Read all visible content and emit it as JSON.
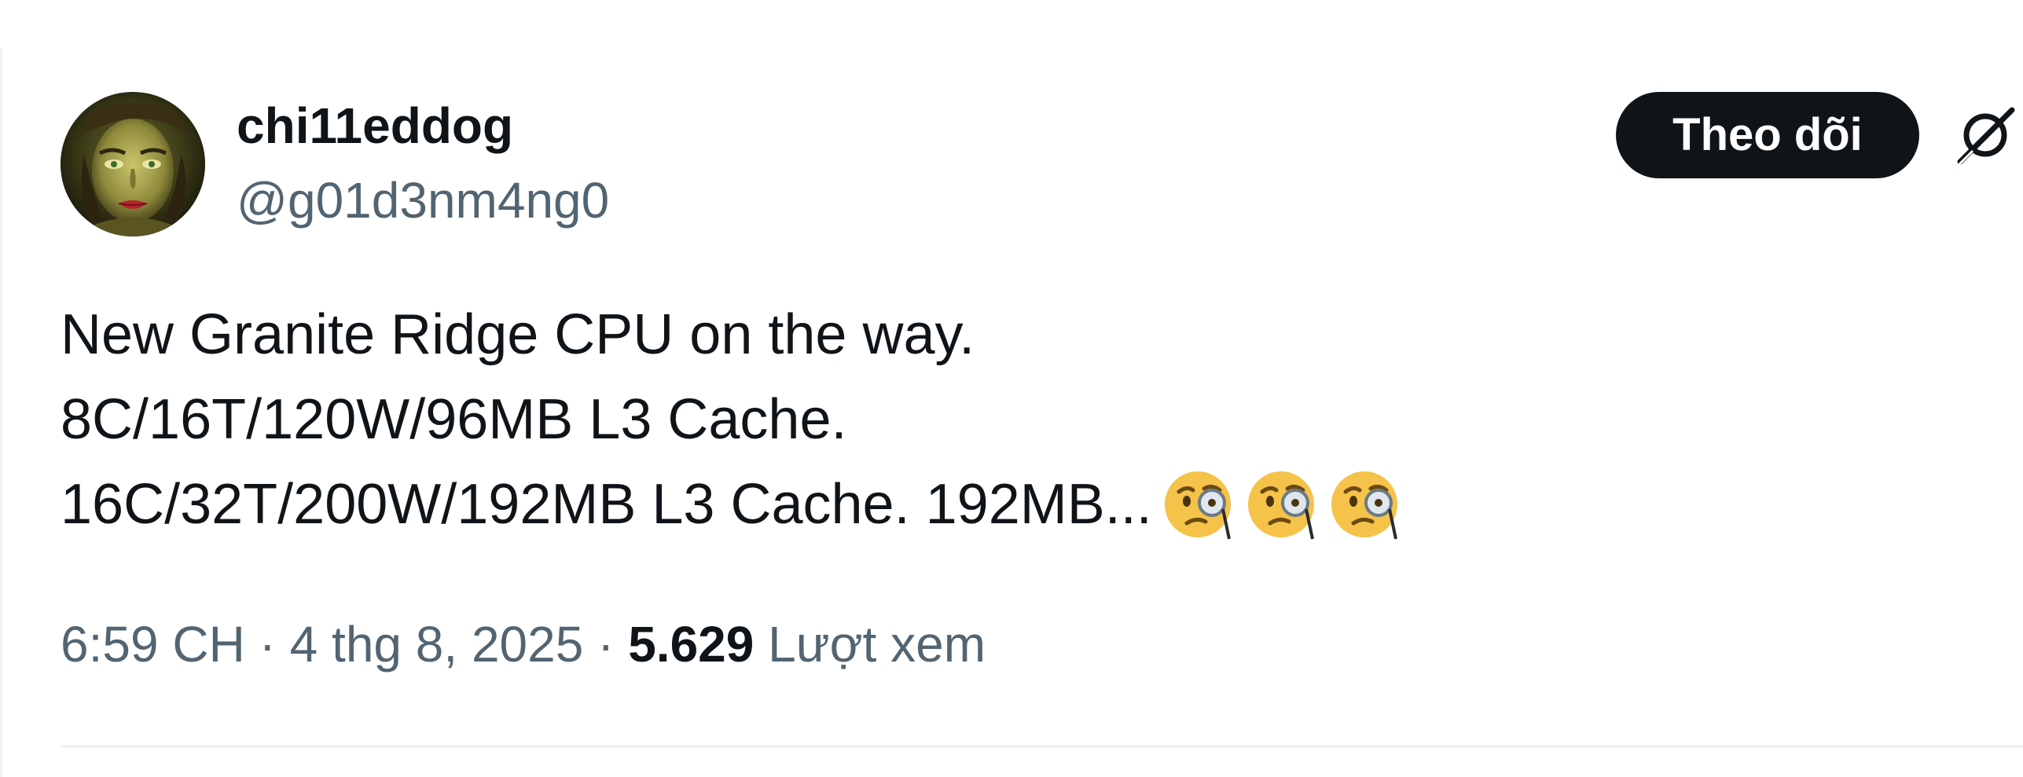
{
  "author": {
    "name": "chi11eddog",
    "handle": "@g01d3nm4ng0"
  },
  "actions": {
    "follow_label": "Theo dõi",
    "grok_icon": "grok-icon"
  },
  "tweet": {
    "lines": [
      "New Granite Ridge CPU on the way.",
      "8C/16T/120W/96MB L3 Cache.",
      "16C/32T/200W/192MB L3 Cache. 192MB..."
    ],
    "trailing_emoji": [
      "face-with-monocle",
      "face-with-monocle",
      "face-with-monocle"
    ]
  },
  "meta": {
    "time": "6:59 CH",
    "separator": " · ",
    "date": "4 thg 8, 2025",
    "views_count": "5.629",
    "views_label": "Lượt xem"
  },
  "colors": {
    "text_primary": "#0f1419",
    "text_secondary": "#536471",
    "button_bg": "#0f1419",
    "divider": "#eff3f4"
  }
}
